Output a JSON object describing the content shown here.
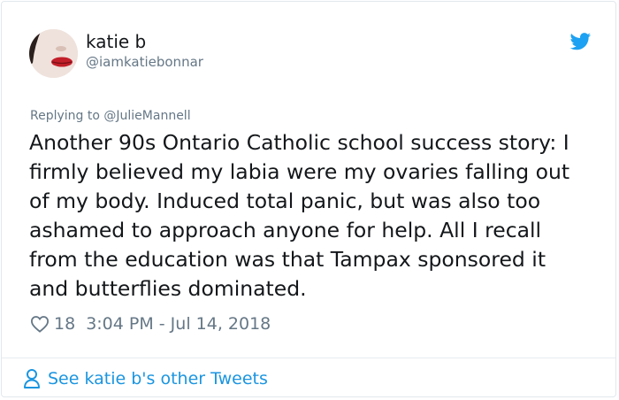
{
  "tweet": {
    "author_name": "katie b",
    "author_handle": "@iamkatiebonnar",
    "replying_prefix": "Replying to ",
    "replying_to": "@JulieMannell",
    "text_lines": [
      "Another 90s Ontario Catholic school success story: I",
      "firmly believed my labia were my ovaries falling out",
      "of my body. Induced total panic, but was also too",
      "ashamed to approach anyone for help. All I recall",
      "from the education was that Tampax sponsored it",
      "and butterflies dominated."
    ],
    "like_count": "18",
    "timestamp": "3:04 PM - Jul 14, 2018"
  },
  "footer": {
    "link_text": "See katie b's other Tweets"
  },
  "icons": {
    "brand": "twitter-bird-icon",
    "like": "heart-icon",
    "profile": "person-icon"
  },
  "colors": {
    "brand_blue": "#1da1f2",
    "link_blue": "#1b95e0",
    "secondary_text": "#657786",
    "primary_text": "#14171a"
  }
}
